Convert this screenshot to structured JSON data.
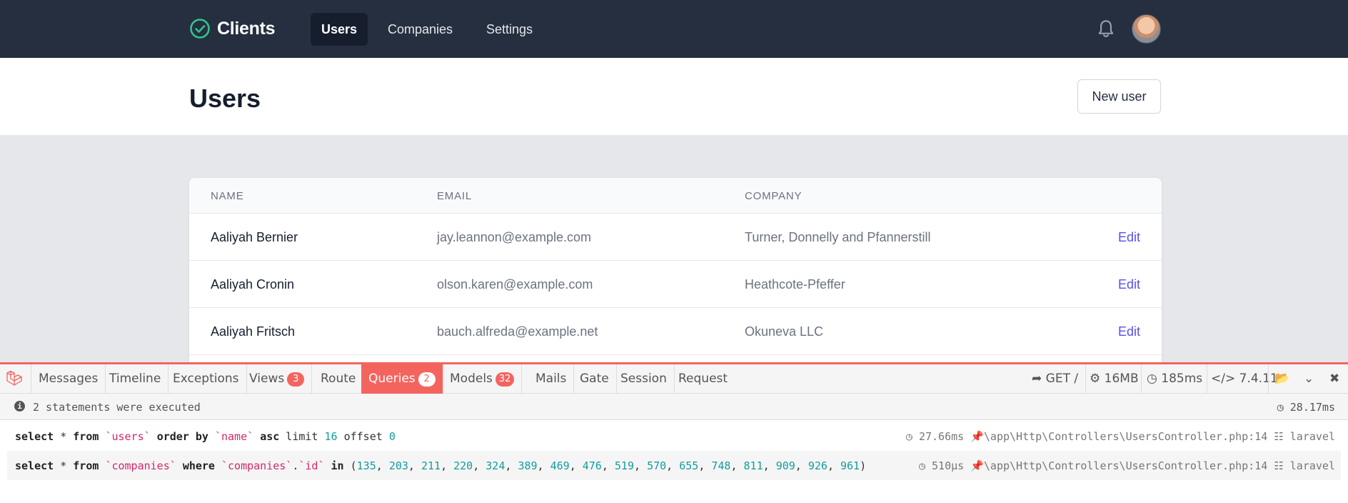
{
  "app": {
    "brand": "Clients",
    "nav": [
      "Users",
      "Companies",
      "Settings"
    ],
    "active_nav": "Users",
    "notification_icon": "bell-icon",
    "avatar_icon": "user-avatar"
  },
  "header": {
    "title": "Users",
    "new_button": "New user"
  },
  "table": {
    "columns": [
      "NAME",
      "EMAIL",
      "COMPANY"
    ],
    "rows": [
      {
        "name": "Aaliyah Bernier",
        "email": "jay.leannon@example.com",
        "company": "Turner, Donnelly and Pfannerstill",
        "action": "Edit"
      },
      {
        "name": "Aaliyah Cronin",
        "email": "olson.karen@example.com",
        "company": "Heathcote-Pfeffer",
        "action": "Edit"
      },
      {
        "name": "Aaliyah Fritsch",
        "email": "bauch.alfreda@example.net",
        "company": "Okuneva LLC",
        "action": "Edit"
      }
    ]
  },
  "debugbar": {
    "tabs": [
      {
        "label": "Messages"
      },
      {
        "label": "Timeline"
      },
      {
        "label": "Exceptions"
      },
      {
        "label": "Views",
        "badge": "3"
      },
      {
        "label": "Route"
      },
      {
        "label": "Queries",
        "badge": "2"
      },
      {
        "label": "Models",
        "badge": "32"
      },
      {
        "label": "Mails"
      },
      {
        "label": "Gate"
      },
      {
        "label": "Session"
      },
      {
        "label": "Request"
      }
    ],
    "active_tab": "Queries",
    "request": "GET /",
    "memory": "16MB",
    "duration": "185ms",
    "php_version": "7.4.11",
    "status_message": "2 statements were executed",
    "total_time": "28.17ms",
    "statements": [
      {
        "sql": "select * from `users` order by `name` asc limit 16 offset 0",
        "time": "27.66ms",
        "source": "\\app\\Http\\Controllers\\UsersController.php:14",
        "connection": "laravel"
      },
      {
        "sql": "select * from `companies` where `companies`.`id` in (135, 203, 211, 220, 324, 389, 469, 476, 519, 570, 655, 748, 811, 909, 926, 961)",
        "time": "510μs",
        "source": "\\app\\Http\\Controllers\\UsersController.php:14",
        "connection": "laravel"
      }
    ]
  },
  "colors": {
    "nav_bg": "#252f3f",
    "accent": "#5850ec",
    "debug_accent": "#f4645f",
    "brand_check": "#31c48d"
  }
}
